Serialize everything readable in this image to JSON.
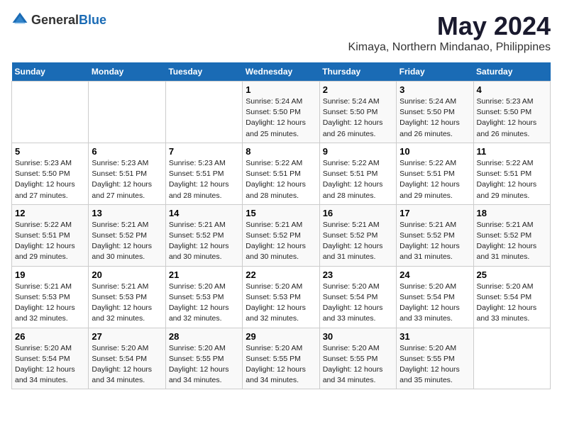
{
  "logo": {
    "general": "General",
    "blue": "Blue"
  },
  "header": {
    "title": "May 2024",
    "subtitle": "Kimaya, Northern Mindanao, Philippines"
  },
  "weekdays": [
    "Sunday",
    "Monday",
    "Tuesday",
    "Wednesday",
    "Thursday",
    "Friday",
    "Saturday"
  ],
  "weeks": [
    [
      {
        "day": "",
        "info": ""
      },
      {
        "day": "",
        "info": ""
      },
      {
        "day": "",
        "info": ""
      },
      {
        "day": "1",
        "info": "Sunrise: 5:24 AM\nSunset: 5:50 PM\nDaylight: 12 hours\nand 25 minutes."
      },
      {
        "day": "2",
        "info": "Sunrise: 5:24 AM\nSunset: 5:50 PM\nDaylight: 12 hours\nand 26 minutes."
      },
      {
        "day": "3",
        "info": "Sunrise: 5:24 AM\nSunset: 5:50 PM\nDaylight: 12 hours\nand 26 minutes."
      },
      {
        "day": "4",
        "info": "Sunrise: 5:23 AM\nSunset: 5:50 PM\nDaylight: 12 hours\nand 26 minutes."
      }
    ],
    [
      {
        "day": "5",
        "info": "Sunrise: 5:23 AM\nSunset: 5:50 PM\nDaylight: 12 hours\nand 27 minutes."
      },
      {
        "day": "6",
        "info": "Sunrise: 5:23 AM\nSunset: 5:51 PM\nDaylight: 12 hours\nand 27 minutes."
      },
      {
        "day": "7",
        "info": "Sunrise: 5:23 AM\nSunset: 5:51 PM\nDaylight: 12 hours\nand 28 minutes."
      },
      {
        "day": "8",
        "info": "Sunrise: 5:22 AM\nSunset: 5:51 PM\nDaylight: 12 hours\nand 28 minutes."
      },
      {
        "day": "9",
        "info": "Sunrise: 5:22 AM\nSunset: 5:51 PM\nDaylight: 12 hours\nand 28 minutes."
      },
      {
        "day": "10",
        "info": "Sunrise: 5:22 AM\nSunset: 5:51 PM\nDaylight: 12 hours\nand 29 minutes."
      },
      {
        "day": "11",
        "info": "Sunrise: 5:22 AM\nSunset: 5:51 PM\nDaylight: 12 hours\nand 29 minutes."
      }
    ],
    [
      {
        "day": "12",
        "info": "Sunrise: 5:22 AM\nSunset: 5:51 PM\nDaylight: 12 hours\nand 29 minutes."
      },
      {
        "day": "13",
        "info": "Sunrise: 5:21 AM\nSunset: 5:52 PM\nDaylight: 12 hours\nand 30 minutes."
      },
      {
        "day": "14",
        "info": "Sunrise: 5:21 AM\nSunset: 5:52 PM\nDaylight: 12 hours\nand 30 minutes."
      },
      {
        "day": "15",
        "info": "Sunrise: 5:21 AM\nSunset: 5:52 PM\nDaylight: 12 hours\nand 30 minutes."
      },
      {
        "day": "16",
        "info": "Sunrise: 5:21 AM\nSunset: 5:52 PM\nDaylight: 12 hours\nand 31 minutes."
      },
      {
        "day": "17",
        "info": "Sunrise: 5:21 AM\nSunset: 5:52 PM\nDaylight: 12 hours\nand 31 minutes."
      },
      {
        "day": "18",
        "info": "Sunrise: 5:21 AM\nSunset: 5:52 PM\nDaylight: 12 hours\nand 31 minutes."
      }
    ],
    [
      {
        "day": "19",
        "info": "Sunrise: 5:21 AM\nSunset: 5:53 PM\nDaylight: 12 hours\nand 32 minutes."
      },
      {
        "day": "20",
        "info": "Sunrise: 5:21 AM\nSunset: 5:53 PM\nDaylight: 12 hours\nand 32 minutes."
      },
      {
        "day": "21",
        "info": "Sunrise: 5:20 AM\nSunset: 5:53 PM\nDaylight: 12 hours\nand 32 minutes."
      },
      {
        "day": "22",
        "info": "Sunrise: 5:20 AM\nSunset: 5:53 PM\nDaylight: 12 hours\nand 32 minutes."
      },
      {
        "day": "23",
        "info": "Sunrise: 5:20 AM\nSunset: 5:54 PM\nDaylight: 12 hours\nand 33 minutes."
      },
      {
        "day": "24",
        "info": "Sunrise: 5:20 AM\nSunset: 5:54 PM\nDaylight: 12 hours\nand 33 minutes."
      },
      {
        "day": "25",
        "info": "Sunrise: 5:20 AM\nSunset: 5:54 PM\nDaylight: 12 hours\nand 33 minutes."
      }
    ],
    [
      {
        "day": "26",
        "info": "Sunrise: 5:20 AM\nSunset: 5:54 PM\nDaylight: 12 hours\nand 34 minutes."
      },
      {
        "day": "27",
        "info": "Sunrise: 5:20 AM\nSunset: 5:54 PM\nDaylight: 12 hours\nand 34 minutes."
      },
      {
        "day": "28",
        "info": "Sunrise: 5:20 AM\nSunset: 5:55 PM\nDaylight: 12 hours\nand 34 minutes."
      },
      {
        "day": "29",
        "info": "Sunrise: 5:20 AM\nSunset: 5:55 PM\nDaylight: 12 hours\nand 34 minutes."
      },
      {
        "day": "30",
        "info": "Sunrise: 5:20 AM\nSunset: 5:55 PM\nDaylight: 12 hours\nand 34 minutes."
      },
      {
        "day": "31",
        "info": "Sunrise: 5:20 AM\nSunset: 5:55 PM\nDaylight: 12 hours\nand 35 minutes."
      },
      {
        "day": "",
        "info": ""
      }
    ]
  ]
}
